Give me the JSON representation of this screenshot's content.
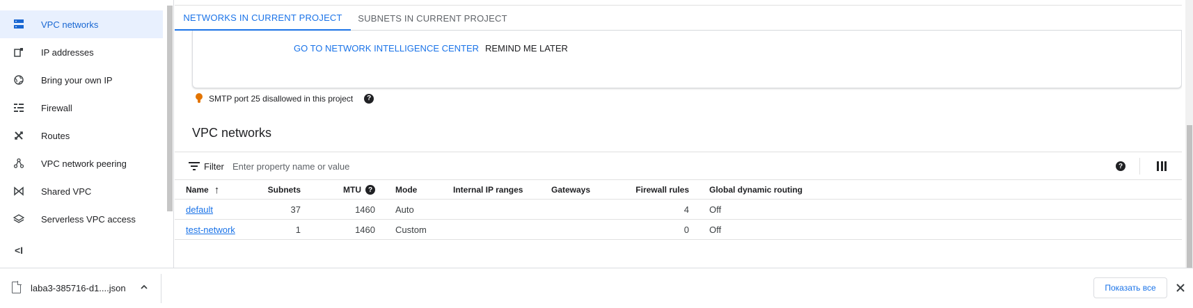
{
  "sidebar": {
    "items": [
      {
        "label": "VPC networks",
        "icon": "vpc-networks-icon",
        "active": true
      },
      {
        "label": "IP addresses",
        "icon": "ip-addresses-icon"
      },
      {
        "label": "Bring your own IP",
        "icon": "globe-icon"
      },
      {
        "label": "Firewall",
        "icon": "firewall-icon"
      },
      {
        "label": "Routes",
        "icon": "routes-icon"
      },
      {
        "label": "VPC network peering",
        "icon": "peering-icon"
      },
      {
        "label": "Shared VPC",
        "icon": "shared-vpc-icon"
      },
      {
        "label": "Serverless VPC access",
        "icon": "serverless-icon"
      }
    ],
    "collapse_glyph": "<I"
  },
  "tabs": [
    {
      "label": "NETWORKS IN CURRENT PROJECT",
      "active": true
    },
    {
      "label": "SUBNETS IN CURRENT PROJECT",
      "active": false
    }
  ],
  "card": {
    "primary_link": "GO TO NETWORK INTELLIGENCE CENTER",
    "secondary_link": "REMIND ME LATER"
  },
  "notice": {
    "text": "SMTP port 25 disallowed in this project",
    "icon": "lightbulb-icon",
    "help_glyph": "?"
  },
  "section_title": "VPC networks",
  "filter": {
    "label": "Filter",
    "placeholder": "Enter property name or value",
    "help_glyph": "?"
  },
  "table": {
    "columns": [
      "Name",
      "Subnets",
      "MTU",
      "Mode",
      "Internal IP ranges",
      "Gateways",
      "Firewall rules",
      "Global dynamic routing"
    ],
    "sort_glyph": "↑",
    "mtu_help_glyph": "?",
    "rows": [
      {
        "name": "default",
        "subnets": "37",
        "mtu": "1460",
        "mode": "Auto",
        "internal_ip_ranges": "",
        "gateways": "",
        "firewall_rules": "4",
        "global_dynamic_routing": "Off"
      },
      {
        "name": "test-network",
        "subnets": "1",
        "mtu": "1460",
        "mode": "Custom",
        "internal_ip_ranges": "",
        "gateways": "",
        "firewall_rules": "0",
        "global_dynamic_routing": "Off"
      }
    ]
  },
  "download_bar": {
    "file_name": "laba3-385716-d1....json",
    "show_all_label": "Показать все"
  },
  "colors": {
    "accent": "#1a73e8",
    "active_bg": "#e8f0fe",
    "warning": "#e37400"
  }
}
